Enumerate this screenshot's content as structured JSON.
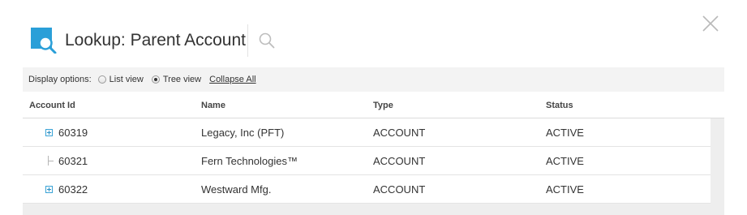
{
  "dialog": {
    "title": "Lookup: Parent Account",
    "icons": {
      "app": "lookup-search-icon",
      "search": "search-icon",
      "close": "close-icon"
    },
    "accent": "#2a9fd8"
  },
  "options": {
    "label": "Display options:",
    "list_view": "List view",
    "tree_view": "Tree view",
    "selected": "tree_view",
    "collapse_all": "Collapse All"
  },
  "table": {
    "headers": {
      "account_id": "Account Id",
      "name": "Name",
      "type": "Type",
      "status": "Status"
    },
    "rows": [
      {
        "account_id": "60319",
        "name": "Legacy, Inc (PFT)",
        "type": "ACCOUNT",
        "status": "ACTIVE",
        "node": "expand"
      },
      {
        "account_id": "60321",
        "name": "Fern Technologies™",
        "type": "ACCOUNT",
        "status": "ACTIVE",
        "node": "leaf"
      },
      {
        "account_id": "60322",
        "name": "Westward Mfg.",
        "type": "ACCOUNT",
        "status": "ACTIVE",
        "node": "expand"
      }
    ]
  }
}
